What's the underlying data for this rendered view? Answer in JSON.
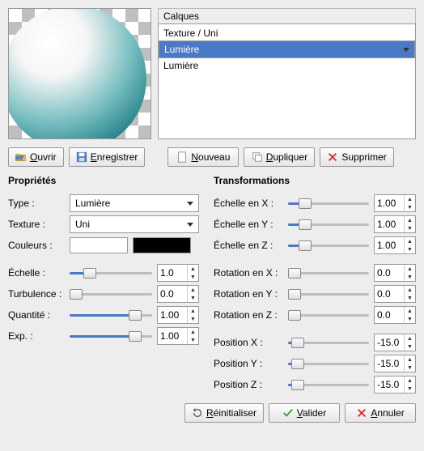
{
  "layers": {
    "title": "Calques",
    "items": [
      "Texture / Uni",
      "Lumière",
      "Lumière"
    ],
    "selected_index": 1
  },
  "buttons": {
    "open": "Ouvrir",
    "save": "Enregistrer",
    "new": "Nouveau",
    "duplicate": "Dupliquer",
    "delete": "Supprimer",
    "reset": "Réinitialiser",
    "ok": "Valider",
    "cancel": "Annuler"
  },
  "properties": {
    "title": "Propriétés",
    "type_label": "Type :",
    "type_value": "Lumière",
    "texture_label": "Texture :",
    "texture_value": "Uni",
    "colors_label": "Couleurs :",
    "color1": "#ffffff",
    "color2": "#000000",
    "scale": {
      "label": "Échelle :",
      "value": "1.0",
      "pct": 20
    },
    "turbulence": {
      "label": "Turbulence :",
      "value": "0.0",
      "pct": 0
    },
    "quantity": {
      "label": "Quantité :",
      "value": "1.00",
      "pct": 85
    },
    "exp": {
      "label": "Exp. :",
      "value": "1.00",
      "pct": 85
    }
  },
  "transforms": {
    "title": "Transformations",
    "scale_x": {
      "label": "Échelle en X :",
      "value": "1.00",
      "pct": 15
    },
    "scale_y": {
      "label": "Échelle en Y :",
      "value": "1.00",
      "pct": 15
    },
    "scale_z": {
      "label": "Échelle en Z :",
      "value": "1.00",
      "pct": 15
    },
    "rot_x": {
      "label": "Rotation en X :",
      "value": "0.0",
      "pct": 0
    },
    "rot_y": {
      "label": "Rotation en Y :",
      "value": "0.0",
      "pct": 0
    },
    "rot_z": {
      "label": "Rotation en Z :",
      "value": "0.0",
      "pct": 0
    },
    "pos_x": {
      "label": "Position X :",
      "value": "-15.0",
      "pct": 5
    },
    "pos_y": {
      "label": "Position Y :",
      "value": "-15.0",
      "pct": 5
    },
    "pos_z": {
      "label": "Position Z :",
      "value": "-15.0",
      "pct": 5
    }
  }
}
